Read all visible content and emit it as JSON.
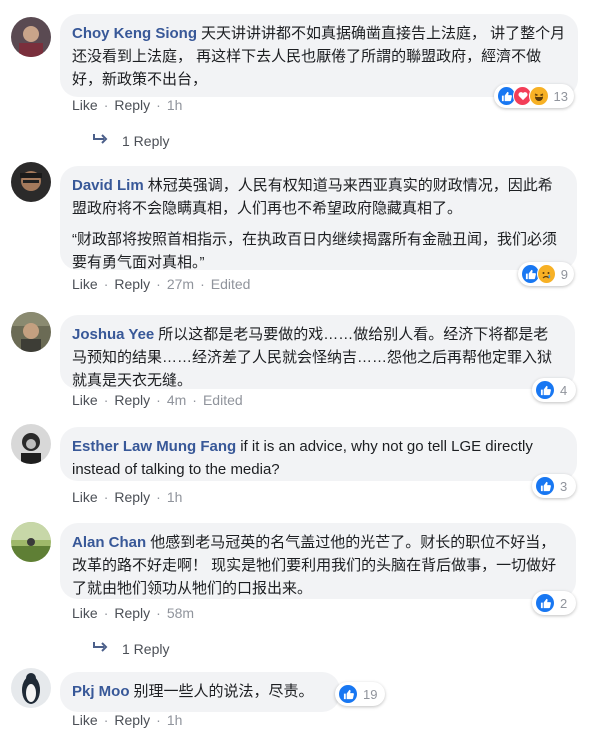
{
  "comments": [
    {
      "name": "Choy Keng Siong",
      "text": "天天讲讲讲都不如真据确凿直接告上法庭， 讲了整个月还没看到上法庭， 再这样下去人民也厭倦了所謂的聯盟政府，經濟不做好，新政策不出台，",
      "quote": "",
      "like": "Like",
      "reply": "Reply",
      "time": "1h",
      "edited": "",
      "reaction_count": "13",
      "reactions": [
        "like",
        "love",
        "haha"
      ],
      "replies_label": "1 Reply"
    },
    {
      "name": "David Lim",
      "text": "林冠英强调，人民有权知道马来西亚真实的财政情况，因此希盟政府将不会隐瞒真相，人们再也不希望政府隐藏真相了。",
      "quote": "“财政部将按照首相指示，在执政百日内继续揭露所有金融丑闻，我们必须要有勇气面对真相。”",
      "like": "Like",
      "reply": "Reply",
      "time": "27m",
      "edited": "Edited",
      "reaction_count": "9",
      "reactions": [
        "like",
        "sad"
      ],
      "replies_label": ""
    },
    {
      "name": "Joshua Yee",
      "text": "所以这都是老马要做的戏……做给别人看。经济下将都是老马预知的结果……经济差了人民就会怪纳吉……怨他之后再帮他定罪入狱就真是天衣无缝。",
      "quote": "",
      "like": "Like",
      "reply": "Reply",
      "time": "4m",
      "edited": "Edited",
      "reaction_count": "4",
      "reactions": [
        "like"
      ],
      "replies_label": ""
    },
    {
      "name": "Esther Law Mung Fang",
      "text": "if it is an advice, why not go tell LGE directly instead of talking to the media?",
      "quote": "",
      "like": "Like",
      "reply": "Reply",
      "time": "1h",
      "edited": "",
      "reaction_count": "3",
      "reactions": [
        "like"
      ],
      "replies_label": ""
    },
    {
      "name": "Alan Chan",
      "text": "他感到老马冠英的名气盖过他的光芒了。财长的职位不好当，改革的路不好走啊！ 现实是牠们要利用我们的头脑在背后做事，一切做好了就由牠们领功从牠们的口报出来。",
      "quote": "",
      "like": "Like",
      "reply": "Reply",
      "time": "58m",
      "edited": "",
      "reaction_count": "2",
      "reactions": [
        "like"
      ],
      "replies_label": "1 Reply"
    },
    {
      "name": "Pkj Moo",
      "text": "别理一些人的说法，尽责。",
      "quote": "",
      "like": "Like",
      "reply": "Reply",
      "time": "1h",
      "edited": "",
      "reaction_count": "19",
      "reactions": [
        "like"
      ],
      "replies_label": ""
    }
  ],
  "colors": {
    "name_blue": "#385898",
    "bubble_bg": "#f2f3f5",
    "like_blue": "#1877f2",
    "love_red": "#f33e58",
    "haha_yellow": "#f7b125",
    "meta_gray": "#90949c"
  }
}
